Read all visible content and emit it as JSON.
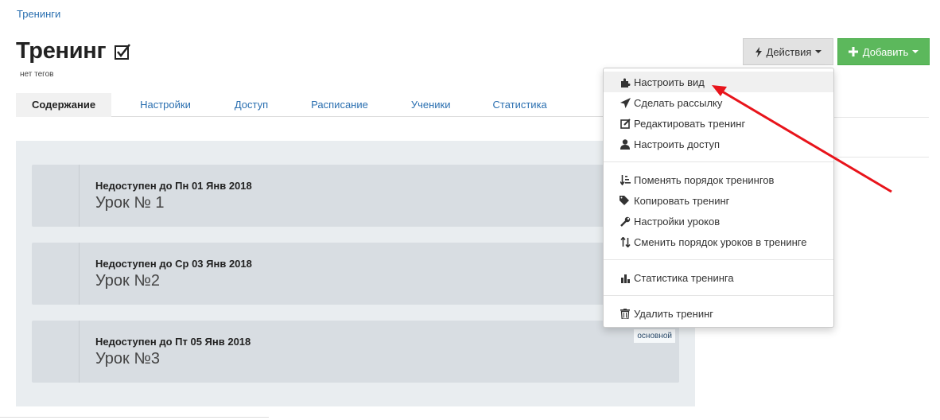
{
  "breadcrumb": "Тренинги",
  "header": {
    "title": "Тренинг",
    "tags": "нет тегов"
  },
  "tabs": [
    {
      "label": "Содержание",
      "active": true
    },
    {
      "label": "Настройки"
    },
    {
      "label": "Доступ"
    },
    {
      "label": "Расписание"
    },
    {
      "label": "Ученики"
    },
    {
      "label": "Статистика"
    }
  ],
  "buttons": {
    "actions": "Действия",
    "add": "Добавить"
  },
  "lessons": [
    {
      "status": "Недоступен до Пн 01 Янв 2018",
      "name": "Урок № 1"
    },
    {
      "status": "Недоступен до Ср 03 Янв 2018",
      "name": "Урок №2"
    },
    {
      "status": "Недоступен до Пт 05 Янв 2018",
      "name": "Урок №3",
      "badge": "основной"
    }
  ],
  "dropdown": {
    "items": [
      {
        "label": "Настроить вид",
        "icon": "puzzle-icon"
      },
      {
        "label": "Сделать рассылку",
        "icon": "paper-plane-icon"
      },
      {
        "label": "Редактировать тренинг",
        "icon": "edit-icon"
      },
      {
        "label": "Настроить доступ",
        "icon": "user-icon"
      },
      {
        "label": "Поменять порядок тренингов",
        "icon": "sort-icon"
      },
      {
        "label": "Копировать тренинг",
        "icon": "tags-icon"
      },
      {
        "label": "Настройки уроков",
        "icon": "wrench-icon"
      },
      {
        "label": "Сменить порядок уроков в тренинге",
        "icon": "swap-icon"
      },
      {
        "label": "Статистика тренинга",
        "icon": "bar-chart-icon"
      },
      {
        "label": "Удалить тренинг",
        "icon": "trash-icon"
      }
    ]
  },
  "colors": {
    "link": "#2a6fb0",
    "add_button": "#5cb85c",
    "arrow": "#e8141b"
  }
}
